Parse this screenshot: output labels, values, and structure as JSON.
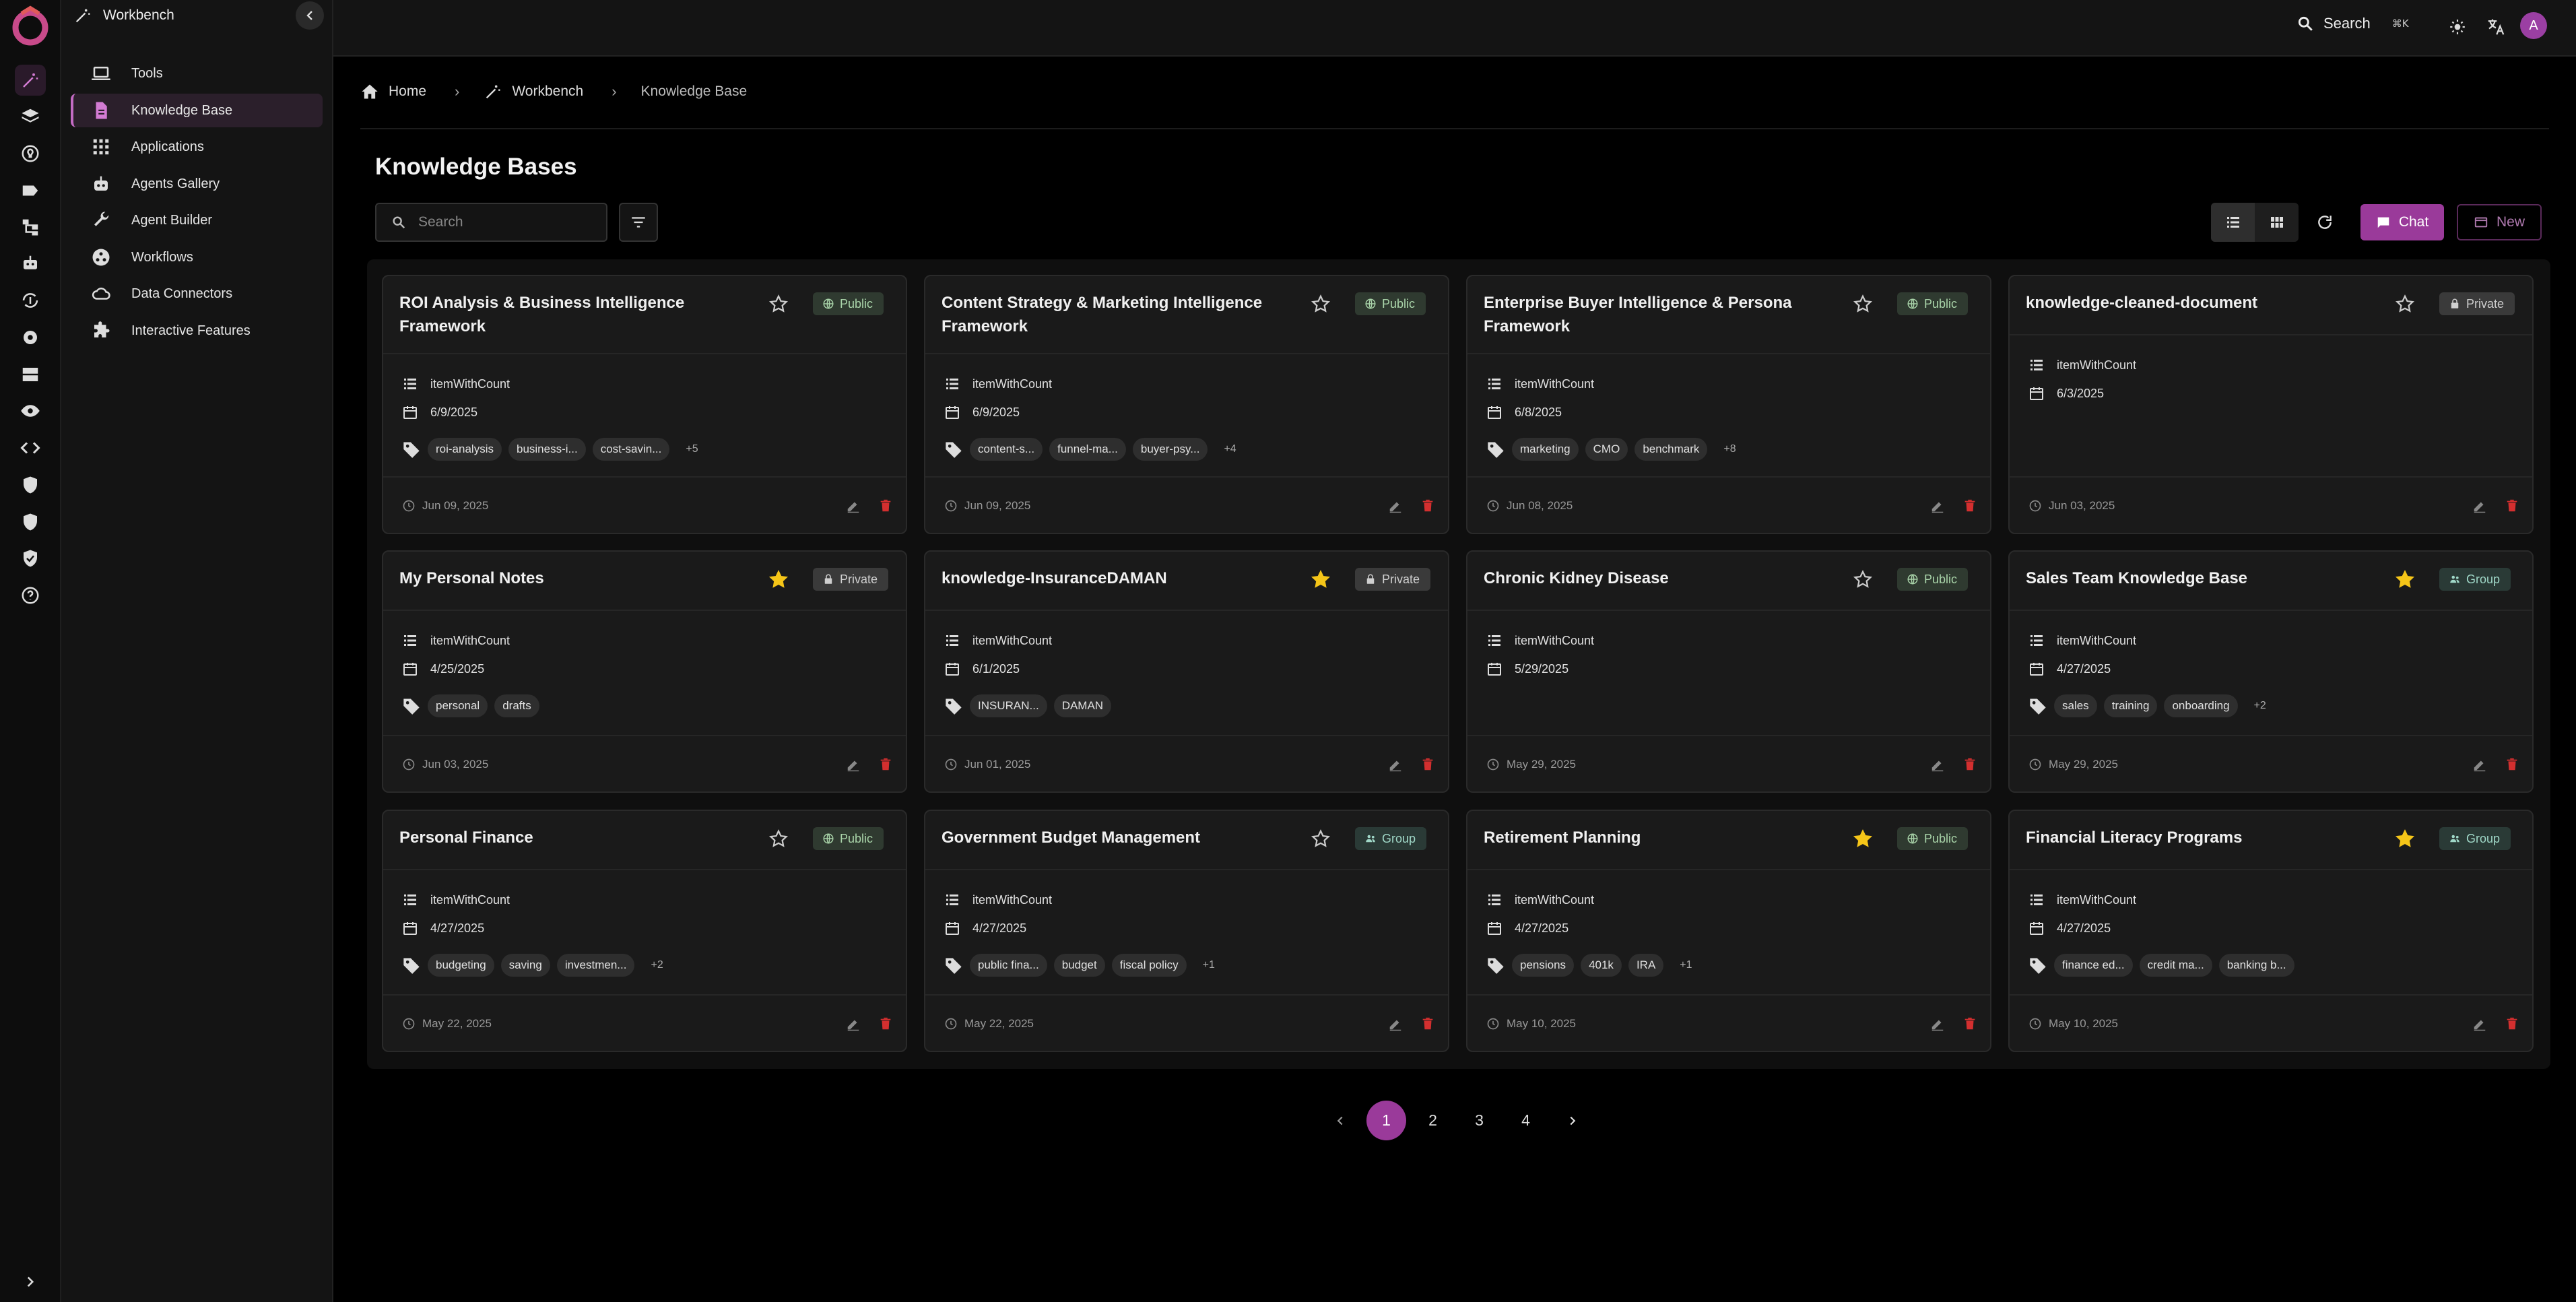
{
  "nav": {
    "title": "Workbench",
    "items": [
      {
        "label": "Tools",
        "icon": "laptop-icon"
      },
      {
        "label": "Knowledge Base",
        "icon": "document-icon"
      },
      {
        "label": "Applications",
        "icon": "apps-grid-icon"
      },
      {
        "label": "Agents Gallery",
        "icon": "robot-icon"
      },
      {
        "label": "Agent Builder",
        "icon": "wrench-icon"
      },
      {
        "label": "Workflows",
        "icon": "workflow-icon"
      },
      {
        "label": "Data Connectors",
        "icon": "cloud-icon"
      },
      {
        "label": "Interactive Features",
        "icon": "puzzle-icon"
      }
    ]
  },
  "topbar": {
    "search_label": "Search",
    "shortcut": "⌘K",
    "avatar_initial": "A"
  },
  "breadcrumb": {
    "home": "Home",
    "workbench": "Workbench",
    "current": "Knowledge Base"
  },
  "page_title": "Knowledge Bases",
  "search": {
    "placeholder": "Search"
  },
  "actions": {
    "chat": "Chat",
    "new": "New"
  },
  "colors": {
    "accent": "#9a3a9a",
    "star": "#f5c518",
    "delete": "#d32f2f"
  },
  "cards": [
    {
      "title": "ROI Analysis & Business Intelligence Framework",
      "starred": false,
      "visibility": "Public",
      "count_label": "itemWithCount",
      "date": "6/9/2025",
      "tags": [
        "roi-analysis",
        "business-i...",
        "cost-savin..."
      ],
      "more": "+5",
      "updated": "Jun 09, 2025"
    },
    {
      "title": "Content Strategy & Marketing Intelligence Framework",
      "starred": false,
      "visibility": "Public",
      "count_label": "itemWithCount",
      "date": "6/9/2025",
      "tags": [
        "content-s...",
        "funnel-ma...",
        "buyer-psy..."
      ],
      "more": "+4",
      "updated": "Jun 09, 2025"
    },
    {
      "title": "Enterprise Buyer Intelligence & Persona Framework",
      "starred": false,
      "visibility": "Public",
      "count_label": "itemWithCount",
      "date": "6/8/2025",
      "tags": [
        "marketing",
        "CMO",
        "benchmark"
      ],
      "more": "+8",
      "updated": "Jun 08, 2025"
    },
    {
      "title": "knowledge-cleaned-document",
      "starred": false,
      "visibility": "Private",
      "count_label": "itemWithCount",
      "date": "6/3/2025",
      "tags": [],
      "more": "",
      "updated": "Jun 03, 2025"
    },
    {
      "title": "My Personal Notes",
      "starred": true,
      "visibility": "Private",
      "count_label": "itemWithCount",
      "date": "4/25/2025",
      "tags": [
        "personal",
        "drafts"
      ],
      "more": "",
      "updated": "Jun 03, 2025"
    },
    {
      "title": "knowledge-InsuranceDAMAN",
      "starred": true,
      "visibility": "Private",
      "count_label": "itemWithCount",
      "date": "6/1/2025",
      "tags": [
        "INSURAN...",
        "DAMAN"
      ],
      "more": "",
      "updated": "Jun 01, 2025"
    },
    {
      "title": "Chronic Kidney Disease",
      "starred": false,
      "visibility": "Public",
      "count_label": "itemWithCount",
      "date": "5/29/2025",
      "tags": [],
      "more": "",
      "updated": "May 29, 2025"
    },
    {
      "title": "Sales Team Knowledge Base",
      "starred": true,
      "visibility": "Group",
      "count_label": "itemWithCount",
      "date": "4/27/2025",
      "tags": [
        "sales",
        "training",
        "onboarding"
      ],
      "more": "+2",
      "updated": "May 29, 2025"
    },
    {
      "title": "Personal Finance",
      "starred": false,
      "visibility": "Public",
      "count_label": "itemWithCount",
      "date": "4/27/2025",
      "tags": [
        "budgeting",
        "saving",
        "investmen..."
      ],
      "more": "+2",
      "updated": "May 22, 2025"
    },
    {
      "title": "Government Budget Management",
      "starred": false,
      "visibility": "Group",
      "count_label": "itemWithCount",
      "date": "4/27/2025",
      "tags": [
        "public fina...",
        "budget",
        "fiscal policy"
      ],
      "more": "+1",
      "updated": "May 22, 2025"
    },
    {
      "title": "Retirement Planning",
      "starred": true,
      "visibility": "Public",
      "count_label": "itemWithCount",
      "date": "4/27/2025",
      "tags": [
        "pensions",
        "401k",
        "IRA"
      ],
      "more": "+1",
      "updated": "May 10, 2025"
    },
    {
      "title": "Financial Literacy Programs",
      "starred": true,
      "visibility": "Group",
      "count_label": "itemWithCount",
      "date": "4/27/2025",
      "tags": [
        "finance ed...",
        "credit ma...",
        "banking b..."
      ],
      "more": "",
      "updated": "May 10, 2025"
    }
  ],
  "pagination": {
    "pages": [
      "1",
      "2",
      "3",
      "4"
    ],
    "current": "1"
  }
}
